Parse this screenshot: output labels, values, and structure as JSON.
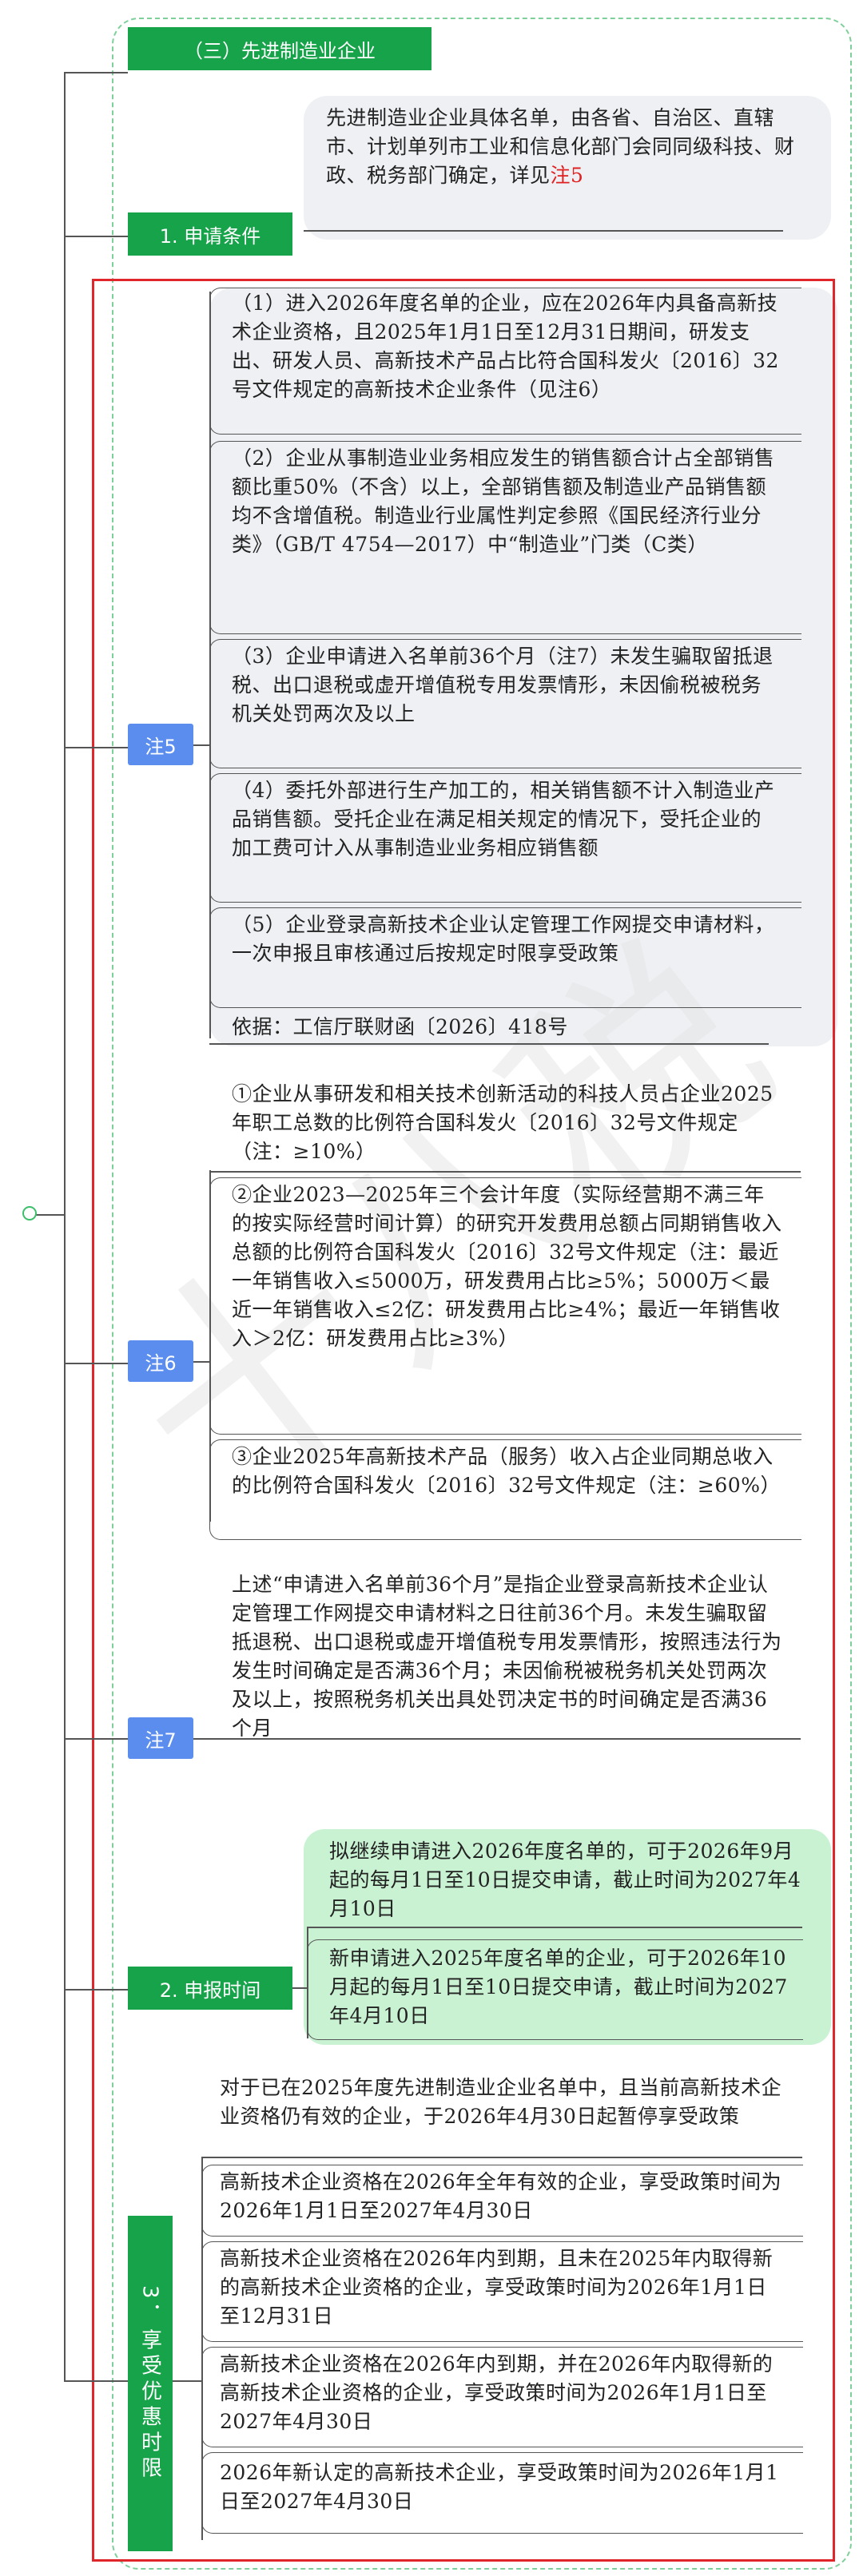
{
  "section_title": "（三）先进制造业企业",
  "apply_condition": {
    "label": "1. 申请条件",
    "text_main": "先进制造业企业具体名单，由各省、自治区、直辖市、计划单列市工业和信息化部门会同同级科技、财政、税务部门确定，详见",
    "text_ref": "注5"
  },
  "note5": {
    "label": "注5",
    "items": [
      "（1）进入2026年度名单的企业，应在2026年内具备高新技术企业资格，且2025年1月1日至12月31日期间，研发支出、研发人员、高新技术产品占比符合国科发火〔2016〕32号文件规定的高新技术企业条件（见注6）",
      "（2）企业从事制造业业务相应发生的销售额合计占全部销售额比重50%（不含）以上，全部销售额及制造业产品销售额均不含增值税。制造业行业属性判定参照《国民经济行业分类》（GB/T 4754—2017）中“制造业”门类（C类）",
      "（3）企业申请进入名单前36个月（注7）未发生骗取留抵退税、出口退税或虚开增值税专用发票情形，未因偷税被税务机关处罚两次及以上",
      "（4）委托外部进行生产加工的，相关销售额不计入制造业产品销售额。受托企业在满足相关规定的情况下，受托企业的加工费可计入从事制造业业务相应销售额",
      "（5）企业登录高新技术企业认定管理工作网提交申请材料，一次申报且审核通过后按规定时限享受政策",
      "依据：工信厅联财函〔2026〕418号"
    ]
  },
  "note6": {
    "label": "注6",
    "items": [
      "①企业从事研发和相关技术创新活动的科技人员占企业2025年职工总数的比例符合国科发火〔2016〕32号文件规定（注：≥10%）",
      "②企业2023—2025年三个会计年度（实际经营期不满三年的按实际经营时间计算）的研究开发费用总额占同期销售收入总额的比例符合国科发火〔2016〕32号文件规定（注：最近一年销售收入≤5000万，研发费用占比≥5%；5000万＜最近一年销售收入≤2亿：研发费用占比≥4%；最近一年销售收入＞2亿：研发费用占比≥3%）",
      "③企业2025年高新技术产品（服务）收入占企业同期总收入的比例符合国科发火〔2016〕32号文件规定（注：≥60%）"
    ]
  },
  "note7": {
    "label": "注7",
    "text": "上述“申请进入名单前36个月”是指企业登录高新技术企业认定管理工作网提交申请材料之日往前36个月。未发生骗取留抵退税、出口退税或虚开增值税专用发票情形，按照违法行为发生时间确定是否满36个月；未因偷税被税务机关处罚两次及以上，按照税务机关出具处罚决定书的时间确定是否满36个月"
  },
  "apply_time": {
    "label": "2. 申报时间",
    "items": [
      "拟继续申请进入2026年度名单的，可于2026年9月起的每月1日至10日提交申请，截止时间为2027年4月10日",
      "新申请进入2025年度名单的企业，可于2026年10月起的每月1日至10日提交申请，截止时间为2027年4月10日"
    ]
  },
  "benefit_time": {
    "label": "3．享受优惠时限",
    "intro": "对于已在2025年度先进制造业企业名单中，且当前高新技术企业资格仍有效的企业，于2026年4月30日起暂停享受政策",
    "items": [
      "高新技术企业资格在2026年全年有效的企业，享受政策时间为2026年1月1日至2027年4月30日",
      "高新技术企业资格在2026年内到期，且未在2025年内取得新的高新技术企业资格的企业，享受政策时间为2026年1月1日至12月31日",
      "高新技术企业资格在2026年内到期，并在2026年内取得新的高新技术企业资格的企业，享受政策时间为2026年1月1日至2027年4月30日",
      "2026年新认定的高新技术企业，享受政策时间为2026年1月1日至2027年4月30日"
    ]
  },
  "watermark": "十八税",
  "colors": {
    "tag_green": "#17a34a",
    "note_blue": "#5b8def",
    "highlight_red": "#e02020",
    "frame_red": "#e0262b",
    "bg_green": "#c9f2d3",
    "bg_grey": "#eef0f3"
  }
}
